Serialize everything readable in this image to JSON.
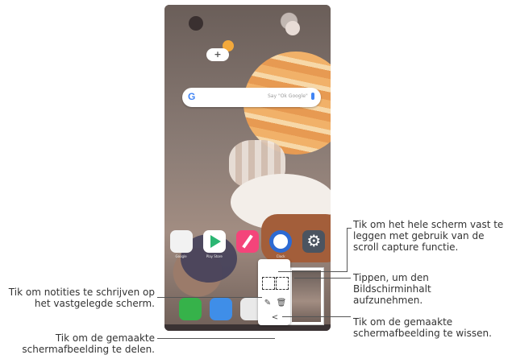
{
  "search": {
    "logo": "G",
    "placeholder": "Say \"Ok Google\""
  },
  "apps_row1": [
    {
      "icon": "tools-folder-icon",
      "label": "Google"
    },
    {
      "icon": "play-store-icon",
      "label": "Play Store"
    },
    {
      "icon": "notes-icon",
      "label": ""
    },
    {
      "icon": "clock-icon",
      "label": "Clock"
    },
    {
      "icon": "settings-icon",
      "label": ""
    }
  ],
  "dock": [
    {
      "icon": "phone-icon"
    },
    {
      "icon": "messages-icon"
    },
    {
      "icon": "camera-icon"
    }
  ],
  "capture_tools": {
    "full": "full-capture-icon",
    "part": "partial-capture-icon",
    "pen": "pen-icon",
    "trash": "trash-icon",
    "share": "share-icon"
  },
  "callouts": {
    "full_capture": "Tik om het hele scherm vast te leggen met gebruik van de scroll capture functie.",
    "partial_capture": "Tippen, um den Bildschirminhalt aufzunehmen.",
    "write_notes": "Tik om notities te schrijven op het vastgelegde scherm.",
    "delete": "Tik om de gemaakte schermafbeelding te wissen.",
    "share": "Tik om de gemaakte schermafbeelding te delen."
  }
}
